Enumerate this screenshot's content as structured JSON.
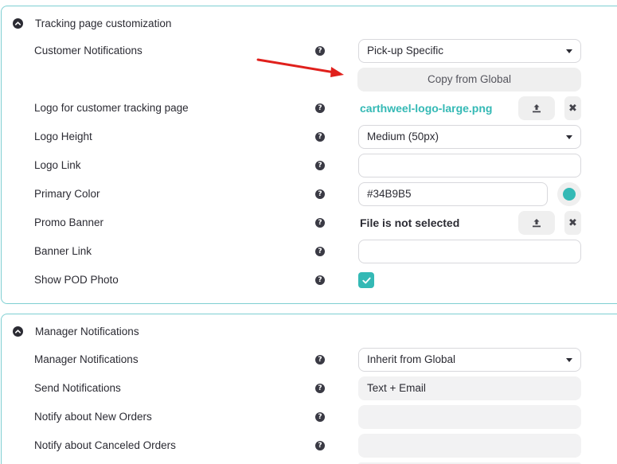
{
  "colors": {
    "accent": "#34B9B5",
    "arrow": "#E0201C"
  },
  "tracking": {
    "title": "Tracking page customization",
    "customer_notifications": {
      "label": "Customer Notifications",
      "value": "Pick-up Specific"
    },
    "copy_button": "Copy from Global",
    "logo": {
      "label": "Logo for customer tracking page",
      "file": "carthweel-logo-large.png"
    },
    "logo_height": {
      "label": "Logo Height",
      "value": "Medium (50px)"
    },
    "logo_link": {
      "label": "Logo Link",
      "value": ""
    },
    "primary_color": {
      "label": "Primary Color",
      "value": "#34B9B5"
    },
    "promo_banner": {
      "label": "Promo Banner",
      "file": "File is not selected"
    },
    "banner_link": {
      "label": "Banner Link",
      "value": ""
    },
    "show_pod_photo": {
      "label": "Show POD Photo",
      "checked": true
    }
  },
  "manager": {
    "title": "Manager Notifications",
    "manager_notifications": {
      "label": "Manager Notifications",
      "value": "Inherit from Global"
    },
    "send_notifications": {
      "label": "Send Notifications",
      "value": "Text + Email"
    },
    "notify_new": {
      "label": "Notify about New Orders",
      "value": ""
    },
    "notify_canceled": {
      "label": "Notify about Canceled Orders",
      "value": ""
    }
  },
  "icons": {
    "help": "?",
    "remove": "✖"
  }
}
